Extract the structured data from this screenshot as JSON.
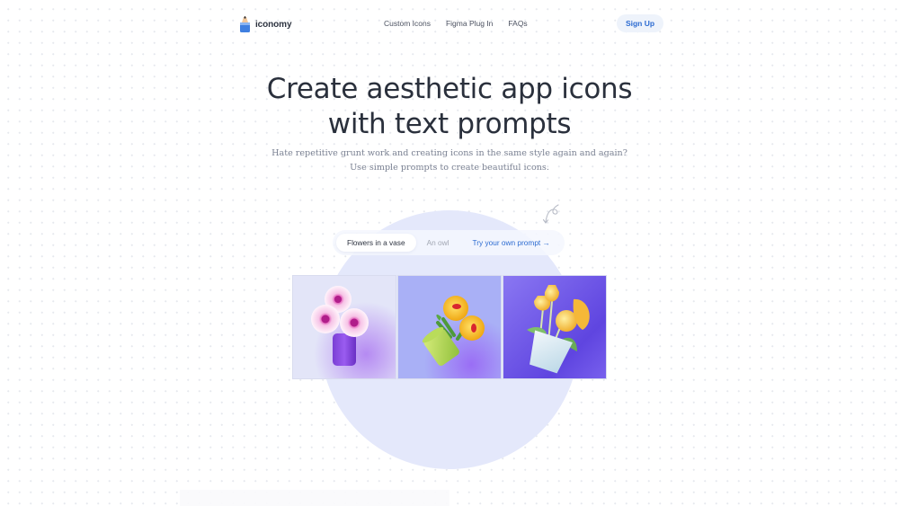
{
  "nav": {
    "logo_text": "iconomy",
    "logo_icon": "pencil-logo-icon",
    "links": [
      "Custom Icons",
      "Figma Plug In",
      "FAQs"
    ],
    "signup_label": "Sign Up"
  },
  "hero": {
    "title_line1": "Create aesthetic app icons",
    "title_line2": "with text prompts",
    "subtitle_line1": "Hate repetitive grunt work and creating icons in the same style again and again?",
    "subtitle_line2": "Use simple prompts to create beautiful icons."
  },
  "prompts": {
    "tabs": [
      "Flowers in a vase",
      "An owl"
    ],
    "active_tab": "Flowers in a vase",
    "try_own_label": "Try your own prompt →",
    "decoration_icon": "curly-arrow-icon"
  },
  "gallery": {
    "images": [
      {
        "label": "flowers-in-purple-vase",
        "bg": "#e3e5f8"
      },
      {
        "label": "yellow-bouquet-in-green-wrap",
        "bg": "#a9b0f6"
      },
      {
        "label": "yellow-flowers-in-white-pot",
        "bg": "#7b69ee"
      }
    ]
  },
  "colors": {
    "accent": "#2c6bd1",
    "text_dark": "#2a303c",
    "text_muted": "#7a8192",
    "arc": "#e4e8fb"
  }
}
